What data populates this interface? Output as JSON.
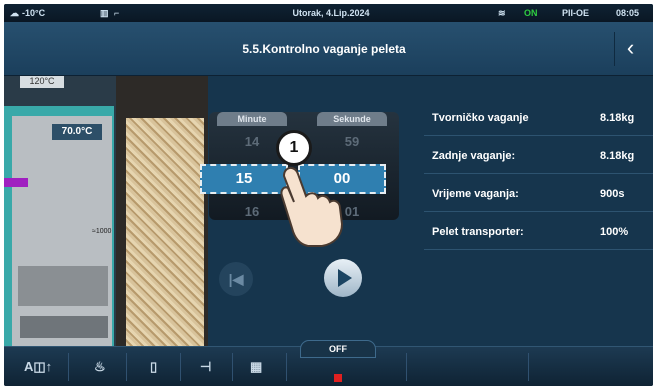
{
  "status_bar": {
    "outside_temp": "-10°C",
    "date": "Utorak, 4.Lip.2024",
    "mode": "PII-OE",
    "time": "08:05",
    "on_badge": "ON"
  },
  "header": {
    "title": "5.5.Kontrolno vaganje peleta",
    "back_icon": "chevron-left-icon"
  },
  "boiler": {
    "top_temp": "120°C",
    "boiler_temp": "70.0°C",
    "level_label": "≈1000"
  },
  "time_picker": {
    "minutes_label": "Minute",
    "seconds_label": "Sekunde",
    "minutes_prev": "14",
    "minutes_value": "15",
    "minutes_next": "16",
    "seconds_prev": "59",
    "seconds_value": "00",
    "seconds_next": "01"
  },
  "controls": {
    "prev_icon": "skip-back-icon",
    "play_icon": "play-icon"
  },
  "info": [
    {
      "label": "Tvorničko vaganje",
      "value": "8.18kg"
    },
    {
      "label": "Zadnje vaganje:",
      "value": "8.18kg"
    },
    {
      "label": "Vrijeme vaganja:",
      "value": "900s"
    },
    {
      "label": "Pelet transporter:",
      "value": "100%"
    }
  ],
  "callout": {
    "step": "1"
  },
  "bottom_bar": {
    "off_label": "OFF",
    "icons": [
      "auto-mode-icon",
      "flame-icon",
      "boiler-icon",
      "tap-icon",
      "radiator-icon"
    ]
  },
  "colors": {
    "accent": "#2f7fb0",
    "panel": "#16354d",
    "off_indicator": "#e02020"
  }
}
